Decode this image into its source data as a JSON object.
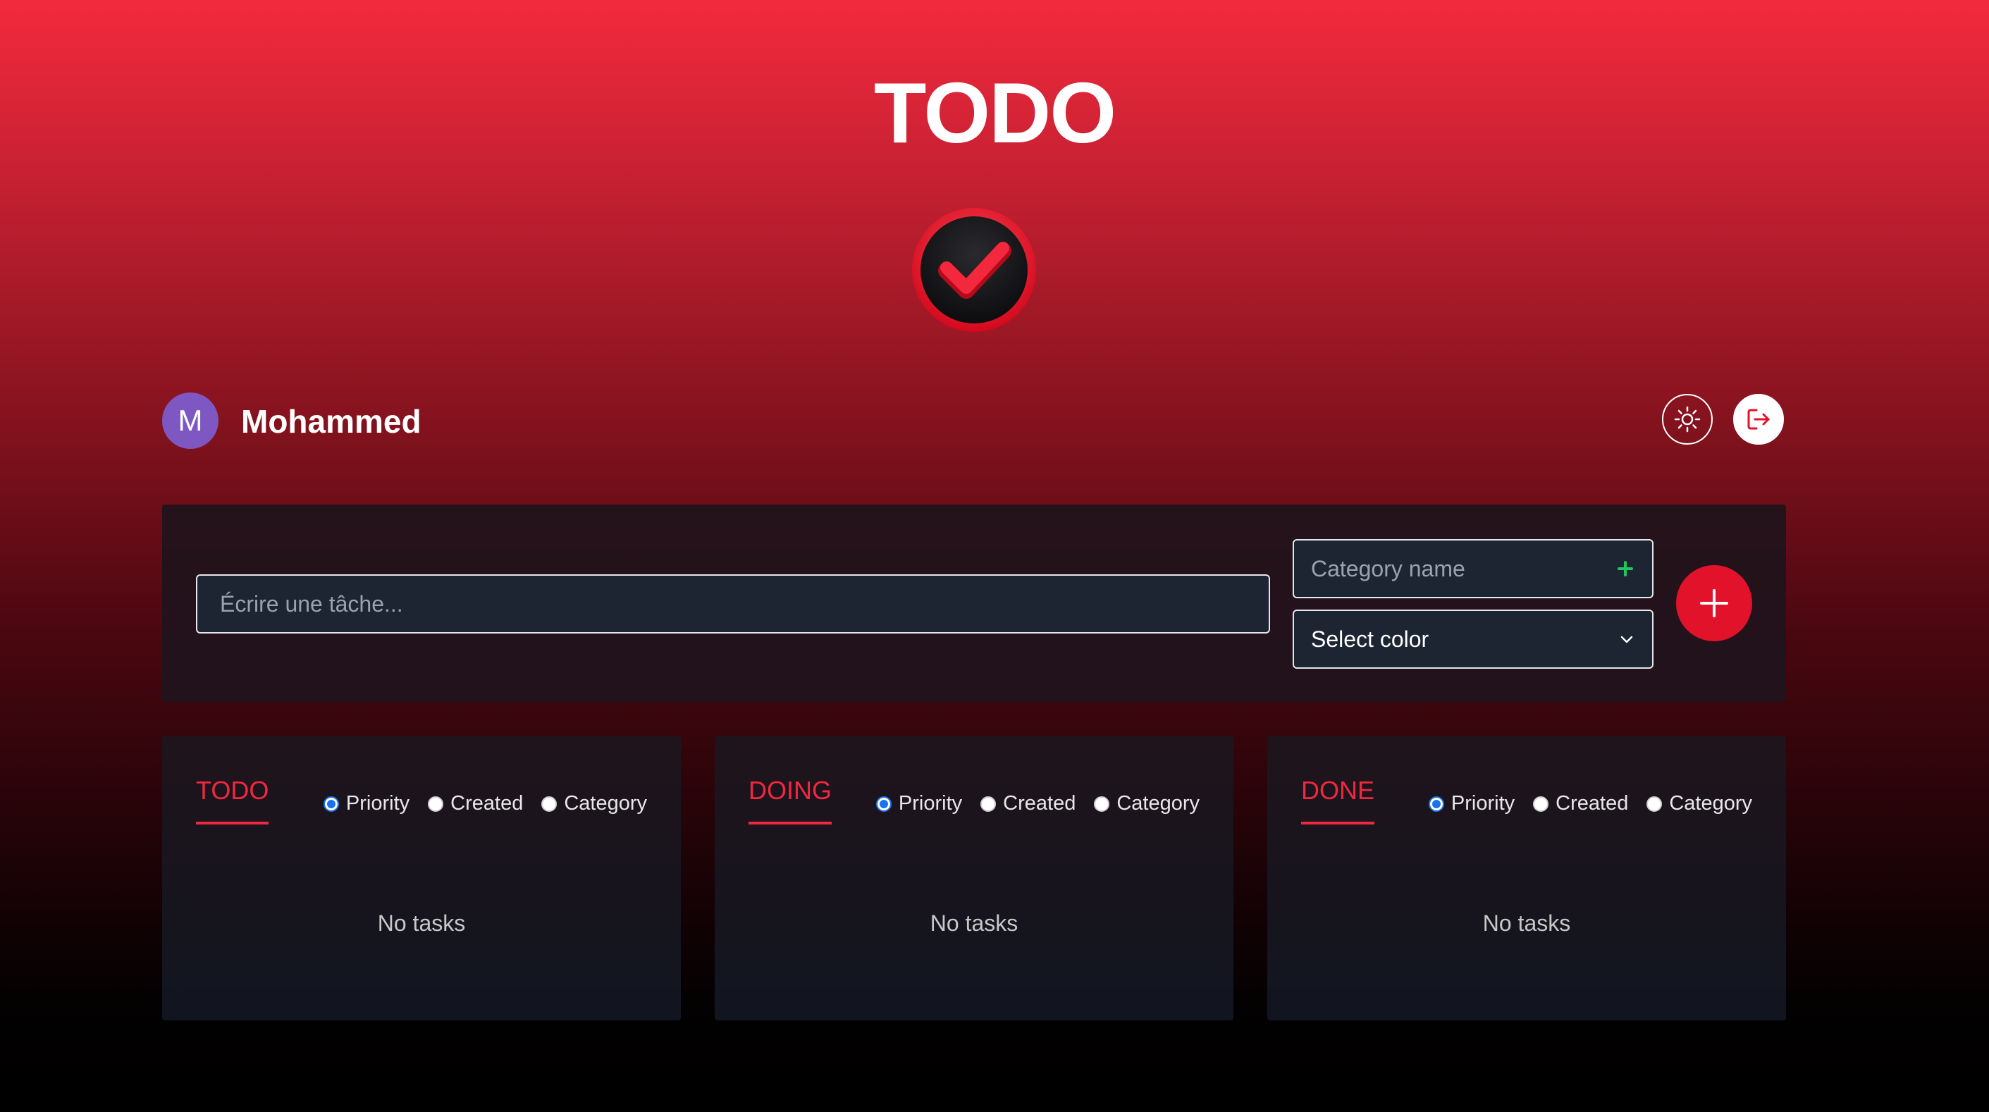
{
  "app": {
    "title": "TODO",
    "logo_icon": "checkmark-badge-icon"
  },
  "user": {
    "avatar_initial": "M",
    "name": "Mohammed",
    "avatar_color": "#7e57c2"
  },
  "header_actions": {
    "theme_icon": "sun-icon",
    "logout_icon": "logout-icon"
  },
  "task_form": {
    "task_placeholder": "Écrire une tâche...",
    "category_placeholder": "Category name",
    "category_add_icon": "plus-icon",
    "color_select_label": "Select color",
    "add_button_icon": "plus-icon"
  },
  "columns": [
    {
      "title": "TODO",
      "sort_options": [
        "Priority",
        "Created",
        "Category"
      ],
      "selected_sort": "Priority",
      "empty_text": "No tasks"
    },
    {
      "title": "DOING",
      "sort_options": [
        "Priority",
        "Created",
        "Category"
      ],
      "selected_sort": "Priority",
      "empty_text": "No tasks"
    },
    {
      "title": "DONE",
      "sort_options": [
        "Priority",
        "Created",
        "Category"
      ],
      "selected_sort": "Priority",
      "empty_text": "No tasks"
    }
  ],
  "colors": {
    "accent": "#f0283f",
    "add_button": "#e3122b",
    "category_plus": "#22c55e",
    "radio_selected": "#1a73e8"
  }
}
